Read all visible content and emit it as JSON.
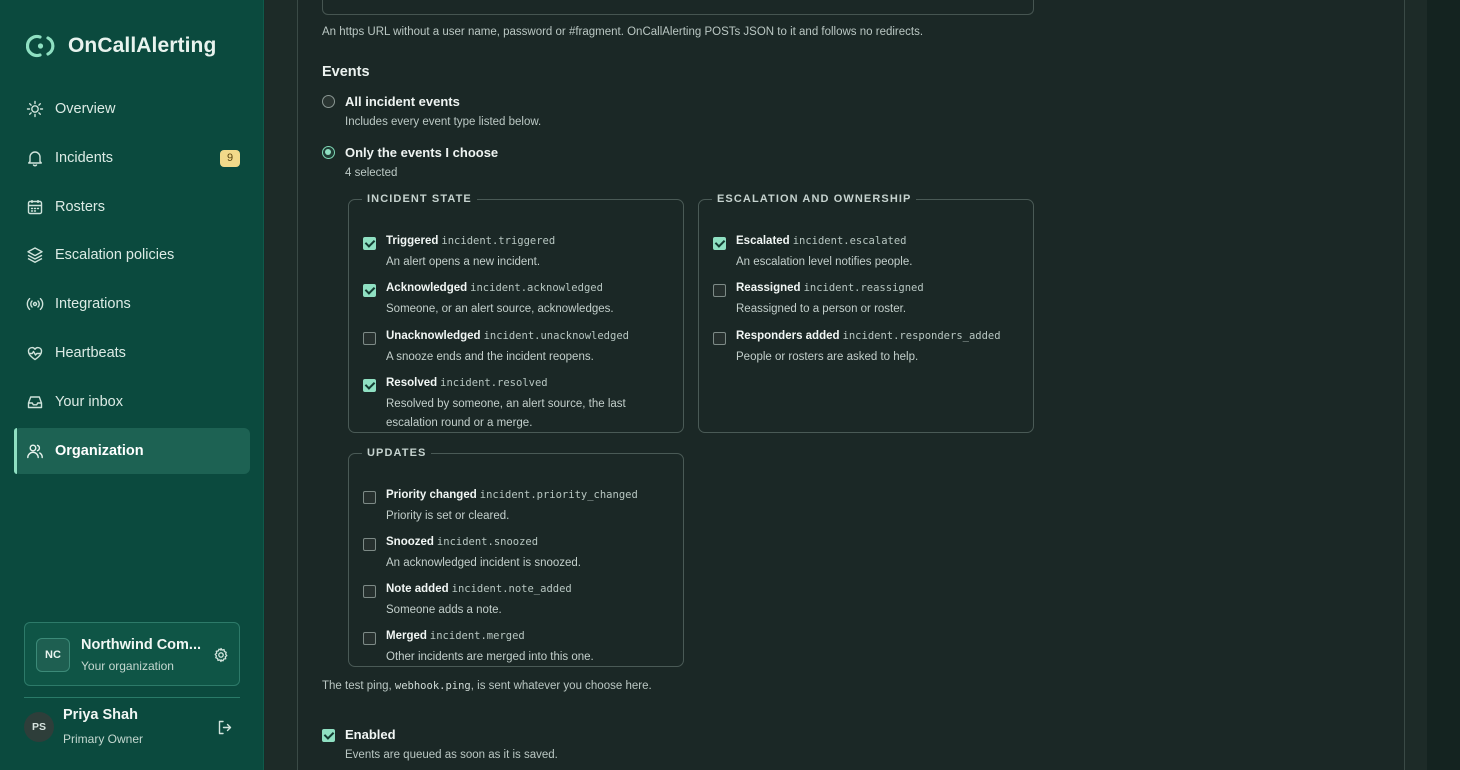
{
  "brand": {
    "name": "OnCallAlerting",
    "accent": "#8fe0c2"
  },
  "sidebar": {
    "items": [
      {
        "label": "Overview",
        "icon": "sun-icon"
      },
      {
        "label": "Incidents",
        "icon": "bell-icon",
        "badge": "9"
      },
      {
        "label": "Rosters",
        "icon": "calendar-icon"
      },
      {
        "label": "Escalation policies",
        "icon": "layers-icon"
      },
      {
        "label": "Integrations",
        "icon": "broadcast-icon"
      },
      {
        "label": "Heartbeats",
        "icon": "heart-pulse-icon"
      },
      {
        "label": "Your inbox",
        "icon": "inbox-icon"
      },
      {
        "label": "Organization",
        "icon": "users-icon",
        "active": true
      }
    ],
    "org": {
      "initials": "NC",
      "name": "Northwind Com...",
      "subtitle": "Your organization"
    },
    "user": {
      "initials": "PS",
      "name": "Priya Shah",
      "role": "Primary Owner"
    }
  },
  "form": {
    "url_hint": "An https URL without a user name, password or #fragment. OnCallAlerting POSTs JSON to it and follows no redirects.",
    "events_title": "Events",
    "all_option": {
      "label": "All incident events",
      "sub": "Includes every event type listed below.",
      "selected": false
    },
    "choose_option": {
      "label": "Only the events I choose",
      "sub": "4 selected",
      "selected": true
    },
    "groups": [
      {
        "legend": "INCIDENT STATE",
        "options": [
          {
            "name": "Triggered",
            "code": "incident.triggered",
            "desc": "An alert opens a new incident.",
            "checked": true
          },
          {
            "name": "Acknowledged",
            "code": "incident.acknowledged",
            "desc": "Someone, or an alert source, acknowledges.",
            "checked": true
          },
          {
            "name": "Unacknowledged",
            "code": "incident.unacknowledged",
            "desc": "A snooze ends and the incident reopens.",
            "checked": false
          },
          {
            "name": "Resolved",
            "code": "incident.resolved",
            "desc_line1": "Resolved by someone, an alert source, the last",
            "desc_line2": "escalation round or a merge.",
            "checked": true
          }
        ]
      },
      {
        "legend": "ESCALATION AND OWNERSHIP",
        "options": [
          {
            "name": "Escalated",
            "code": "incident.escalated",
            "desc": "An escalation level notifies people.",
            "checked": true
          },
          {
            "name": "Reassigned",
            "code": "incident.reassigned",
            "desc": "Reassigned to a person or roster.",
            "checked": false
          },
          {
            "name": "Responders added",
            "code": "incident.responders_added",
            "desc": "People or rosters are asked to help.",
            "checked": false
          }
        ]
      },
      {
        "legend": "UPDATES",
        "options": [
          {
            "name": "Priority changed",
            "code": "incident.priority_changed",
            "desc": "Priority is set or cleared.",
            "checked": false
          },
          {
            "name": "Snoozed",
            "code": "incident.snoozed",
            "desc": "An acknowledged incident is snoozed.",
            "checked": false
          },
          {
            "name": "Note added",
            "code": "incident.note_added",
            "desc": "Someone adds a note.",
            "checked": false
          },
          {
            "name": "Merged",
            "code": "incident.merged",
            "desc": "Other incidents are merged into this one.",
            "checked": false
          }
        ]
      }
    ],
    "ping_hint_before": "The test ping,",
    "ping_code": "webhook.ping",
    "ping_hint_after": ", is sent whatever you choose here.",
    "enabled": {
      "label": "Enabled",
      "sub": "Events are queued as soon as it is saved.",
      "checked": true
    }
  }
}
